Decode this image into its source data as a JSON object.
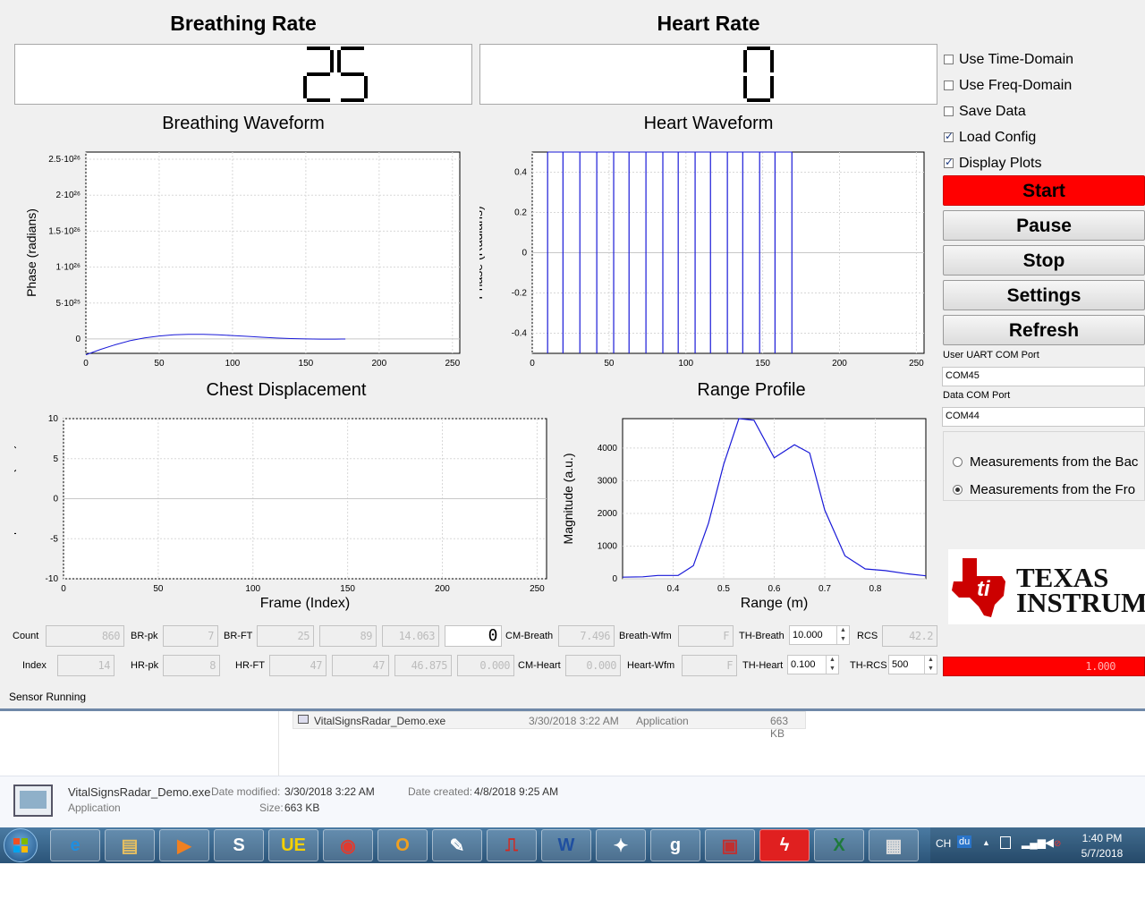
{
  "rates": {
    "breathing_title": "Breathing Rate",
    "breathing_value": "25",
    "heart_title": "Heart Rate",
    "heart_value": "0"
  },
  "options": {
    "use_time_domain": {
      "label": "Use Time-Domain",
      "checked": false
    },
    "use_freq_domain": {
      "label": "Use Freq-Domain",
      "checked": false
    },
    "save_data": {
      "label": "Save Data",
      "checked": false
    },
    "load_config": {
      "label": "Load Config",
      "checked": true
    },
    "display_plots": {
      "label": "Display Plots",
      "checked": true
    }
  },
  "buttons": {
    "start": "Start",
    "pause": "Pause",
    "stop": "Stop",
    "settings": "Settings",
    "refresh": "Refresh"
  },
  "ports": {
    "user_label": "User UART COM Port",
    "user_value": "COM45",
    "data_label": "Data COM Port",
    "data_value": "COM44"
  },
  "measurement": {
    "option_back": "Measurements from the Bac",
    "option_front": "Measurements from the Fro",
    "selected": "front"
  },
  "logo": {
    "line1": "TEXAS",
    "line2": "INSTRUM",
    "color": "#cc0000"
  },
  "plots": {
    "breathing": {
      "title": "Breathing Waveform",
      "ylabel": "Phase (radians)",
      "xticks": [
        "0",
        "50",
        "100",
        "150",
        "200",
        "250"
      ],
      "yticks": [
        "2.5·10²⁶",
        "2·10²⁶",
        "1.5·10²⁶",
        "1·10²⁶",
        "5·10²⁵",
        "0"
      ]
    },
    "heart": {
      "title": "Heart Waveform",
      "ylabel": "Phase (Radians)",
      "xticks": [
        "0",
        "50",
        "100",
        "150",
        "200",
        "250"
      ],
      "yticks": [
        "0.4",
        "0.2",
        "0",
        "-0.2",
        "-0.4"
      ]
    },
    "chest": {
      "title": "Chest Displacement",
      "ylabel": "Displacement (a.u.)",
      "xlabel": "Frame (Index)",
      "xticks": [
        "0",
        "50",
        "100",
        "150",
        "200",
        "250"
      ],
      "yticks": [
        "10",
        "5",
        "0",
        "-5",
        "-10"
      ]
    },
    "range": {
      "title": "Range Profile",
      "ylabel": "Magnitude (a.u.)",
      "xlabel": "Range (m)",
      "xticks": [
        "0.4",
        "0.5",
        "0.6",
        "0.7",
        "0.8"
      ],
      "yticks": [
        "4000",
        "3000",
        "2000",
        "1000",
        "0"
      ]
    }
  },
  "chart_data": [
    {
      "type": "line",
      "title": "Breathing Waveform",
      "ylabel": "Phase (radians)",
      "xlim": [
        0,
        255
      ],
      "ylim": [
        -2e+25,
        2.6e+26
      ],
      "x": [
        0,
        10,
        20,
        30,
        40,
        50,
        60,
        70,
        80,
        90,
        100,
        110,
        120,
        130,
        140,
        150,
        160,
        170,
        177
      ],
      "y": [
        -2.2e+25,
        -1.45e+25,
        -8e+24,
        -2.5e+24,
        1.5e+24,
        4.2e+24,
        5.8e+24,
        6.5e+24,
        6.4e+24,
        5.8e+24,
        4.8e+24,
        3.6e+24,
        2.4e+24,
        1.3e+24,
        5e+23,
        0,
        -2e+23,
        -2e+23,
        -1e+23
      ]
    },
    {
      "type": "line",
      "title": "Heart Waveform",
      "ylabel": "Phase (Radians)",
      "xlim": [
        0,
        255
      ],
      "ylim": [
        -0.5,
        0.5
      ],
      "spike_x": [
        10,
        20,
        31,
        42,
        53,
        63,
        74,
        85,
        95,
        106,
        116,
        127,
        137,
        148,
        158,
        169
      ]
    },
    {
      "type": "line",
      "title": "Chest Displacement",
      "xlabel": "Frame (Index)",
      "ylabel": "Displacement (a.u.)",
      "xlim": [
        0,
        255
      ],
      "ylim": [
        -10,
        10
      ],
      "x": [],
      "y": []
    },
    {
      "type": "line",
      "title": "Range Profile",
      "xlabel": "Range (m)",
      "ylabel": "Magnitude (a.u.)",
      "xlim": [
        0.3,
        0.9
      ],
      "ylim": [
        0,
        4900
      ],
      "x": [
        0.3,
        0.34,
        0.37,
        0.41,
        0.44,
        0.47,
        0.5,
        0.53,
        0.56,
        0.6,
        0.64,
        0.67,
        0.7,
        0.74,
        0.78,
        0.82,
        0.86,
        0.9
      ],
      "y": [
        50,
        60,
        100,
        100,
        400,
        1700,
        3500,
        4900,
        4850,
        3700,
        4100,
        3850,
        2100,
        700,
        300,
        250,
        160,
        90
      ]
    }
  ],
  "bottom": {
    "count_label": "Count",
    "count_value": "860",
    "br_pk_label": "BR-pk",
    "br_pk_value": "7",
    "br_ft_label": "BR-FT",
    "br_ft_value": "25",
    "br_ft_value2": "89",
    "br_ft_value3": "14.063",
    "cm_breath_value": "0",
    "cm_breath_label": "CM-Breath",
    "cm_breath_num": "7.496",
    "breath_wfm_label": "Breath-Wfm",
    "breath_wfm_value": "F",
    "th_breath_label": "TH-Breath",
    "th_breath_value": "10.000",
    "rcs_label": "RCS",
    "rcs_value": "42.2",
    "index_label": "Index",
    "index_value": "14",
    "hr_pk_label": "HR-pk",
    "hr_pk_value": "8",
    "hr_ft_label": "HR-FT",
    "hr_ft_value": "47",
    "hr_ft_value2": "47",
    "hr_ft_value3": "46.875",
    "cm_heart_value_a": "0.000",
    "cm_heart_label": "CM-Heart",
    "cm_heart_value": "0.000",
    "heart_wfm_label": "Heart-Wfm",
    "heart_wfm_value": "F",
    "th_heart_label": "TH-Heart",
    "th_heart_value": "0.100",
    "th_rcs_label": "TH-RCS",
    "th_rcs_value": "500",
    "red_value": "1.000"
  },
  "status": "Sensor Running",
  "explorer": {
    "list_name": "VitalSignsRadar_Demo.exe",
    "list_date": "3/30/2018 3:22 AM",
    "list_type": "Application",
    "list_size": "663 KB",
    "detail_name": "VitalSignsRadar_Demo.exe",
    "date_modified_label": "Date modified:",
    "date_modified": "3/30/2018 3:22 AM",
    "date_created_label": "Date created:",
    "date_created": "4/8/2018 9:25 AM",
    "detail_type": "Application",
    "size_label": "Size:",
    "size": "663 KB"
  },
  "taskbar": {
    "lang": "CH",
    "ime": "du",
    "time": "1:40 PM",
    "date": "5/7/2018",
    "apps": [
      "ie-icon",
      "folder-icon",
      "media-player-icon",
      "skype-icon",
      "ultraedit-icon",
      "chrome-icon",
      "outlook-icon",
      "paint-icon",
      "pdf-icon",
      "word-icon",
      "safari-icon",
      "cloud-app-icon",
      "toolbox-icon",
      "flash-app-icon",
      "excel-icon",
      "vitalsigns-app-icon"
    ]
  }
}
